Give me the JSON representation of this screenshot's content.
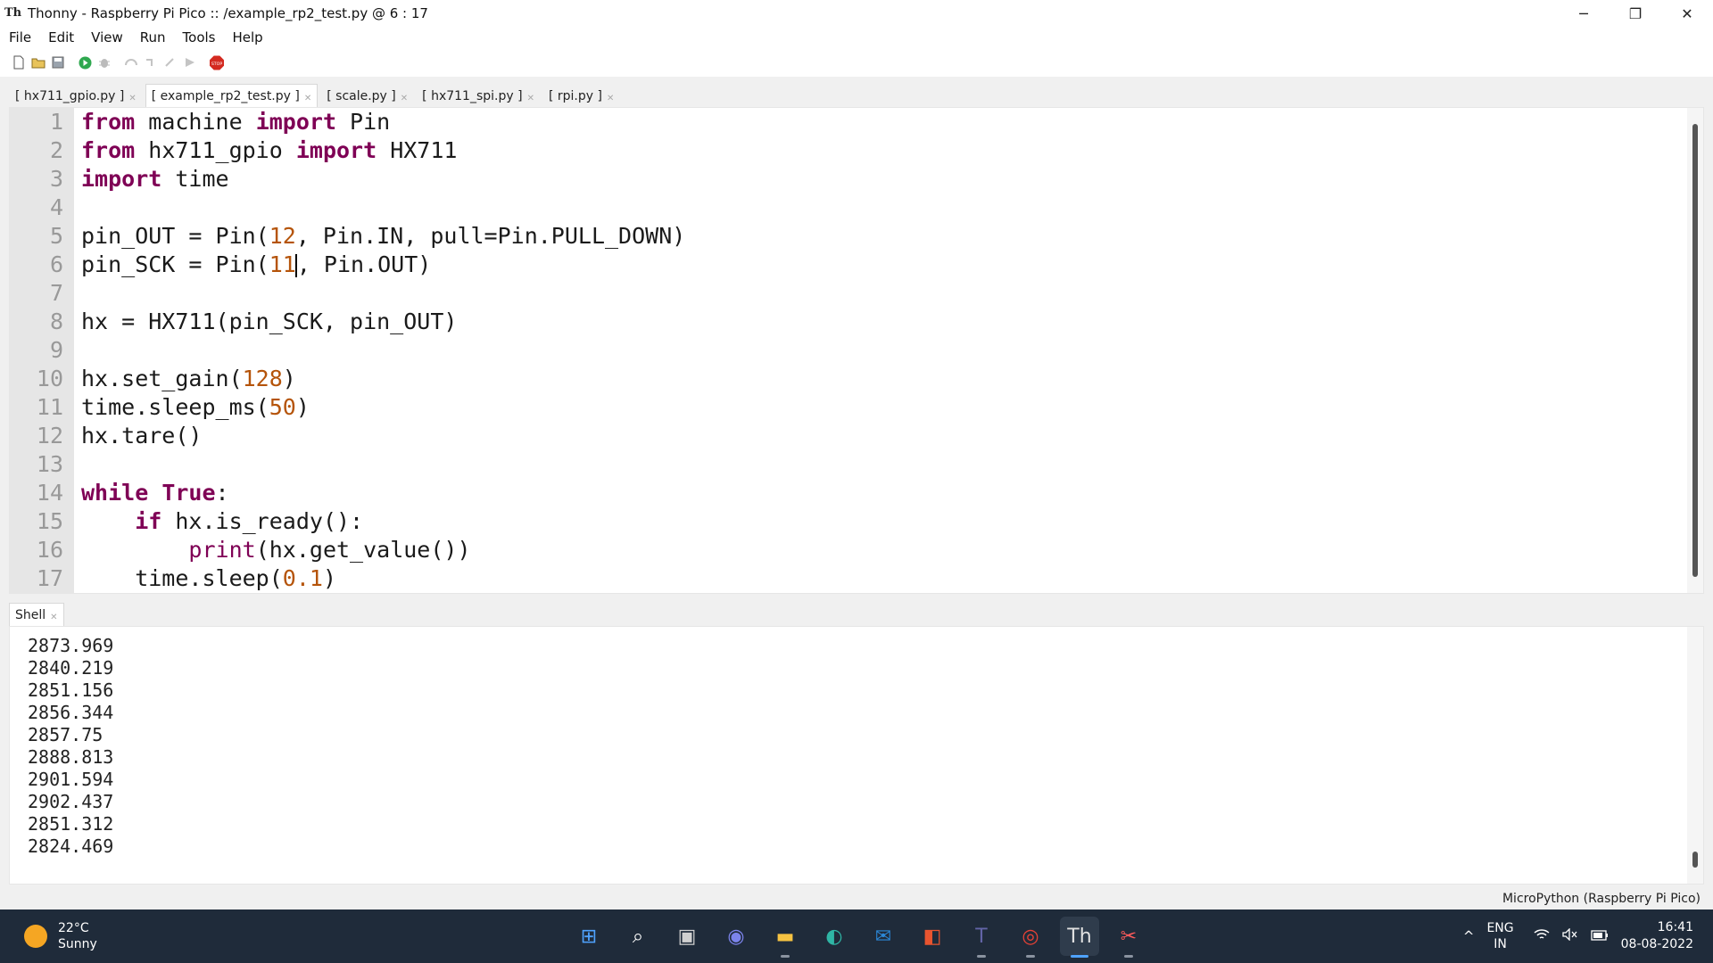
{
  "window": {
    "title": "Thonny  -  Raspberry Pi Pico :: /example_rp2_test.py  @  6 : 17",
    "app_icon_text": "Th",
    "controls": {
      "minimize": "─",
      "restore": "❐",
      "close": "✕"
    }
  },
  "menu": [
    "File",
    "Edit",
    "View",
    "Run",
    "Tools",
    "Help"
  ],
  "toolbar": {
    "icons": [
      "new-file-icon",
      "open-file-icon",
      "save-icon",
      "run-icon",
      "debug-icon",
      "step-over-icon",
      "step-into-icon",
      "step-out-icon",
      "resume-icon",
      "stop-icon"
    ],
    "stop_label": "STOP"
  },
  "tabs": [
    {
      "label": "[ hx711_gpio.py ]",
      "active": false
    },
    {
      "label": "[ example_rp2_test.py ]",
      "active": true
    },
    {
      "label": "[ scale.py ]",
      "active": false
    },
    {
      "label": "[ hx711_spi.py ]",
      "active": false
    },
    {
      "label": "[ rpi.py ]",
      "active": false
    }
  ],
  "editor": {
    "caret_line": 6,
    "caret_column": 17,
    "lines": [
      {
        "n": "1",
        "text": "from machine import Pin"
      },
      {
        "n": "2",
        "text": "from hx711_gpio import HX711"
      },
      {
        "n": "3",
        "text": "import time"
      },
      {
        "n": "4",
        "text": ""
      },
      {
        "n": "5",
        "text": "pin_OUT = Pin(12, Pin.IN, pull=Pin.PULL_DOWN)"
      },
      {
        "n": "6",
        "text": "pin_SCK = Pin(11, Pin.OUT)"
      },
      {
        "n": "7",
        "text": ""
      },
      {
        "n": "8",
        "text": "hx = HX711(pin_SCK, pin_OUT)"
      },
      {
        "n": "9",
        "text": ""
      },
      {
        "n": "10",
        "text": "hx.set_gain(128)"
      },
      {
        "n": "11",
        "text": "time.sleep_ms(50)"
      },
      {
        "n": "12",
        "text": "hx.tare()"
      },
      {
        "n": "13",
        "text": ""
      },
      {
        "n": "14",
        "text": "while True:"
      },
      {
        "n": "15",
        "text": "    if hx.is_ready():"
      },
      {
        "n": "16",
        "text": "        print(hx.get_value())"
      },
      {
        "n": "17",
        "text": "    time.sleep(0.1)"
      }
    ]
  },
  "shell": {
    "tab_label": "Shell",
    "output": [
      "2873.969",
      "2840.219",
      "2851.156",
      "2856.344",
      "2857.75",
      "2888.813",
      "2901.594",
      "2902.437",
      "2851.312",
      "2824.469"
    ]
  },
  "status": {
    "interpreter": "MicroPython (Raspberry Pi Pico)"
  },
  "taskbar": {
    "weather_temp": "22°C",
    "weather_desc": "Sunny",
    "apps": [
      {
        "name": "start-icon",
        "glyph": "⊞",
        "color": "#4fa3ff",
        "active": false,
        "running": false
      },
      {
        "name": "search-icon",
        "glyph": "⌕",
        "color": "#ffffff",
        "active": false,
        "running": false
      },
      {
        "name": "task-view-icon",
        "glyph": "▣",
        "color": "#d0d0d0",
        "active": false,
        "running": false
      },
      {
        "name": "teams-chat-icon",
        "glyph": "◉",
        "color": "#7b83eb",
        "active": false,
        "running": false
      },
      {
        "name": "file-explorer-icon",
        "glyph": "▬",
        "color": "#f6c342",
        "active": false,
        "running": true
      },
      {
        "name": "edge-icon",
        "glyph": "◐",
        "color": "#2fb5a5",
        "active": false,
        "running": false
      },
      {
        "name": "mail-icon",
        "glyph": "✉",
        "color": "#2b88d8",
        "active": false,
        "running": false
      },
      {
        "name": "office-icon",
        "glyph": "◧",
        "color": "#e8542f",
        "active": false,
        "running": false
      },
      {
        "name": "teams-icon",
        "glyph": "T",
        "color": "#6264a7",
        "active": false,
        "running": true
      },
      {
        "name": "chrome-icon",
        "glyph": "◎",
        "color": "#e94235",
        "active": false,
        "running": true
      },
      {
        "name": "thonny-icon",
        "glyph": "Th",
        "color": "#e0e0e0",
        "active": true,
        "running": true
      },
      {
        "name": "snipping-tool-icon",
        "glyph": "✂",
        "color": "#ff5b5b",
        "active": false,
        "running": true
      }
    ],
    "tray": {
      "chevron": "^",
      "lang_top": "ENG",
      "lang_bottom": "IN",
      "time": "16:41",
      "date": "08-08-2022"
    }
  }
}
